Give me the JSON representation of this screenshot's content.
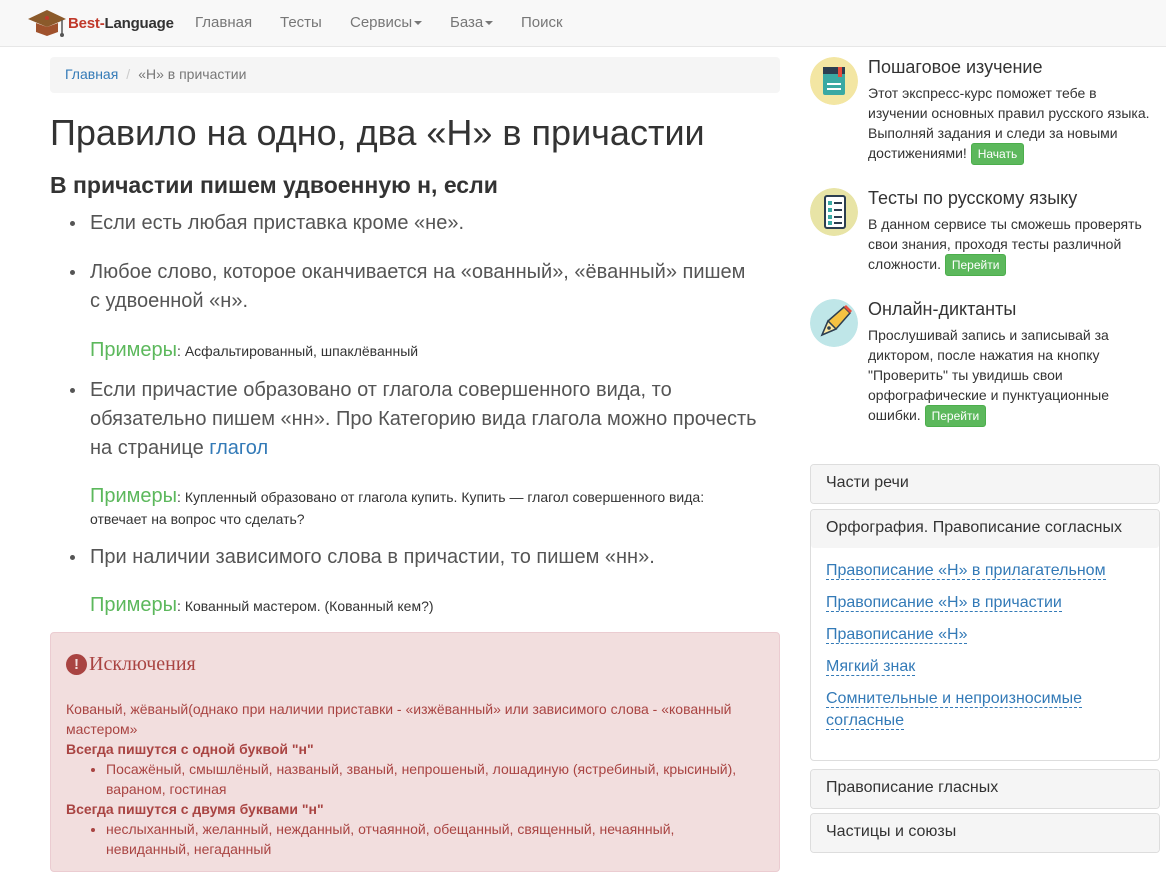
{
  "nav": {
    "brand_part1": "Best-",
    "brand_part2": "Language",
    "items": [
      "Главная",
      "Тесты",
      "Сервисы",
      "База",
      "Поиск"
    ]
  },
  "breadcrumb": {
    "home": "Главная",
    "current": "«Н» в причастии"
  },
  "main": {
    "title": "Правило на одно, два «Н» в причастии",
    "subtitle": "В причастии пишем удвоенную н, если",
    "rules": [
      {
        "text": "Если есть любая приставка кроме «не»."
      },
      {
        "text": "Любое слово, которое оканчивается на «ованный», «ёванный» пишем с удвоенной «н»."
      },
      {
        "text": "Если причастие образовано от глагола совершенного вида, то обязательно пишем «нн». Про Категорию вида глагола можно прочесть на странице ",
        "link": "глагол"
      },
      {
        "text": "При наличии зависимого слова в причастии, то пишем «нн»."
      }
    ],
    "example_label": "Примеры",
    "examples": [
      ": Асфальтированный, шпаклёванный",
      ": Купленный образовано от глагола купить. Купить — глагол совершенного вида: отвечает на вопрос что сделать?",
      ": Кованный мастером. (Кованный кем?)"
    ]
  },
  "exceptions": {
    "icon": "exclamation-circle-icon",
    "title": "Исключения",
    "intro": "Кованый, жёваный(однако при наличии приставки - «изжёванный» или зависимого слова - «кованный мастером»",
    "single_heading": "Всегда пишутся с одной буквой \"н\"",
    "single_list": "Посажёный, смышлёный, названый, званый, непрошеный, лошадиную (ястребиный, крысиный), вараном, гостиная",
    "double_heading": "Всегда пишутся с двумя буквами \"н\"",
    "double_list": "неслыханный, желанный, нежданный, отчаянной, обещанный, священный, нечаянный, невиданный, негаданный"
  },
  "promos": [
    {
      "title": "Пошаговое изучение",
      "text": "Этот экспресс-курс поможет тебе в изучении основных правил русского языка. Выполняй задания и следи за новыми достижениями!",
      "button": "Начать",
      "icon": "book-icon"
    },
    {
      "title": "Тесты по русскому языку",
      "text": "В данном сервисе ты сможешь проверять свои знания, проходя тесты различной сложности.",
      "button": "Перейти",
      "icon": "checklist-icon"
    },
    {
      "title": "Онлайн-диктанты",
      "text": "Прослушивай запись и записывай за диктором, после нажатия на кнопку \"Проверить\" ты увидишь свои орфографические и пунктуационные ошибки.",
      "button": "Перейти",
      "icon": "pen-icon"
    }
  ],
  "accordion": {
    "parts_of_speech": "Части речи",
    "orthography": "Орфография. Правописание согласных",
    "links": [
      "Правописание «Н» в прилагательном",
      "Правописание «Н» в причастии",
      "Правописание «Н»",
      "Мягкий знак",
      "Сомнительные и непроизносимые согласные"
    ],
    "vowels": "Правописание гласных",
    "particles": "Частицы и союзы"
  }
}
